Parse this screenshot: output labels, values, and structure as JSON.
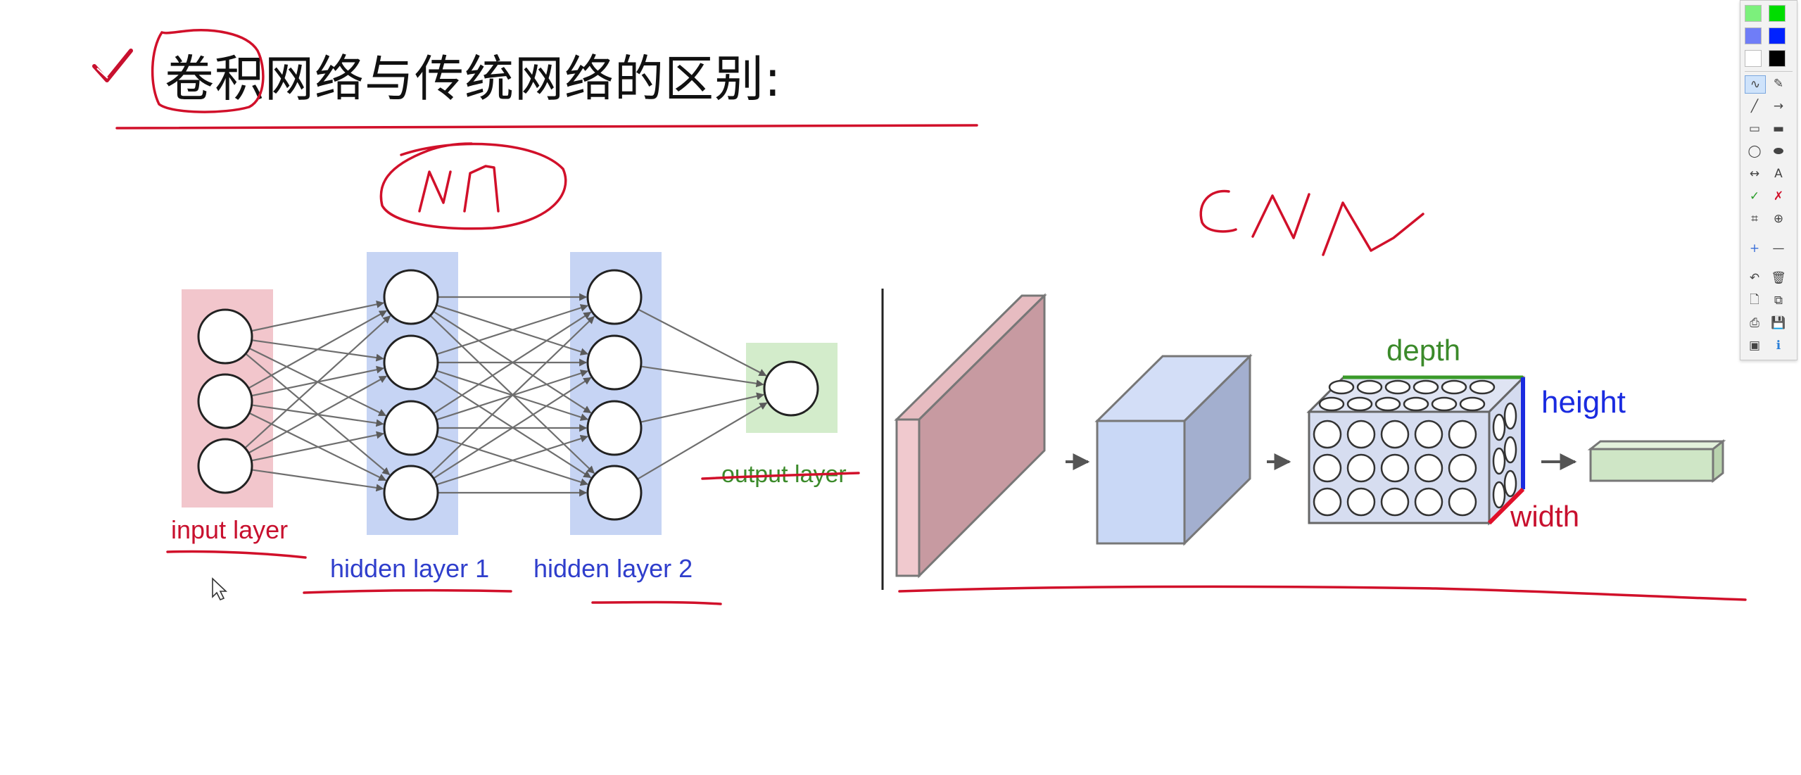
{
  "slide": {
    "title": "卷积网络与传统网络的区别:"
  },
  "nn_diagram": {
    "input_label": "input layer",
    "hidden1_label": "hidden layer 1",
    "hidden2_label": "hidden layer 2",
    "output_label": "output layer"
  },
  "cnn_diagram": {
    "depth_label": "depth",
    "height_label": "height",
    "width_label": "width"
  },
  "handwriting": {
    "nn_note": "NN",
    "cnn_note": "CNN"
  },
  "toolbar": {
    "colors": [
      "#7cf07c",
      "#00dd00",
      "#6f7df7",
      "#0022ff",
      "#ffffff",
      "#000000"
    ],
    "tools": [
      {
        "name": "freehand-pen",
        "glyph": "∿"
      },
      {
        "name": "highlighter",
        "glyph": "✎"
      },
      {
        "name": "line",
        "glyph": "╱"
      },
      {
        "name": "arrow",
        "glyph": "→"
      },
      {
        "name": "rectangle",
        "glyph": "▭"
      },
      {
        "name": "filled-rectangle",
        "glyph": "▬"
      },
      {
        "name": "ellipse",
        "glyph": "◯"
      },
      {
        "name": "filled-ellipse",
        "glyph": "⬬"
      },
      {
        "name": "double-arrow",
        "glyph": "↔"
      },
      {
        "name": "text",
        "glyph": "A"
      },
      {
        "name": "check",
        "glyph": "✓"
      },
      {
        "name": "cross",
        "glyph": "✗"
      },
      {
        "name": "crop",
        "glyph": "⌗"
      },
      {
        "name": "zoom",
        "glyph": "⊕"
      },
      {
        "name": "plus",
        "glyph": "+"
      },
      {
        "name": "minus",
        "glyph": "—"
      },
      {
        "name": "undo",
        "glyph": "↶"
      },
      {
        "name": "trash",
        "glyph": "🗑"
      },
      {
        "name": "new-page",
        "glyph": "🗋"
      },
      {
        "name": "copy",
        "glyph": "⧉"
      },
      {
        "name": "print",
        "glyph": "⎙"
      },
      {
        "name": "save",
        "glyph": "💾"
      },
      {
        "name": "screenshot",
        "glyph": "▣"
      },
      {
        "name": "info",
        "glyph": "ℹ"
      }
    ]
  }
}
